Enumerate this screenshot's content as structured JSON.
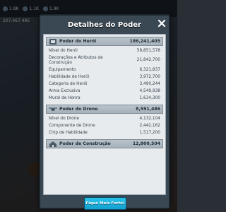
{
  "background": {
    "resources": [
      "1.8K",
      "1.1K",
      "1.9K"
    ],
    "power": "207,467,495"
  },
  "dialog": {
    "title": "Detalhes do Poder",
    "cta_label": "Fique Mais Forte!"
  },
  "hero_section": {
    "label": "Poder do Herói",
    "value": "186,241,405",
    "rows": [
      {
        "label": "Nível do Herói",
        "value": "58,851,578"
      },
      {
        "label": "Decorações e Atributos de Construção",
        "value": "21,842,700"
      },
      {
        "label": "Equipamento",
        "value": "6,321,837"
      },
      {
        "label": "Habilidade de Herói",
        "value": "3,972,700"
      },
      {
        "label": "Categoria de Herói",
        "value": "3,490,244"
      },
      {
        "label": "Arma Exclusiva",
        "value": "4,549,938"
      },
      {
        "label": "Mural de Honra",
        "value": "1,634,300"
      }
    ]
  },
  "drone_section": {
    "label": "Poder do Drone",
    "value": "8,591,486",
    "rows": [
      {
        "label": "Nível do Drone",
        "value": "4,132,104"
      },
      {
        "label": "Componente de Drone",
        "value": "2,442,162"
      },
      {
        "label": "Chip de Habilidade",
        "value": "1,517,200"
      }
    ]
  },
  "construction_section": {
    "label": "Poder de Construção",
    "value": "12,800,504"
  }
}
